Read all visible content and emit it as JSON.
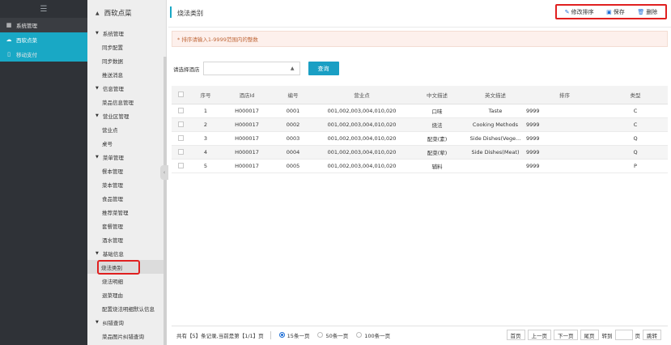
{
  "leftbar": {
    "items": [
      {
        "label": "系统管理",
        "icon": "grid-icon"
      },
      {
        "label": "西软点菜",
        "icon": "cloud-icon"
      },
      {
        "label": "移动支付",
        "icon": "phone-icon"
      }
    ]
  },
  "submenu": {
    "header": "西软点菜",
    "groups": [
      {
        "label": "系统管理",
        "items": [
          "同步配置",
          "同步数据",
          "推送消息"
        ]
      },
      {
        "label": "信息管理",
        "items": [
          "菜品信息管理"
        ]
      },
      {
        "label": "营业区管理",
        "items": [
          "营业点",
          "桌号"
        ]
      },
      {
        "label": "菜单管理",
        "items": [
          "餐本管理",
          "菜本管理",
          "食品管理",
          "推荐菜管理",
          "套餐管理",
          "酒水管理"
        ]
      },
      {
        "label": "基础信息",
        "items": [
          "烧法类别",
          "烧法明细",
          "退菜理由",
          "配置烧法明细默认信息"
        ]
      },
      {
        "label": "纠错查询",
        "items": [
          "菜品图片纠错查询"
        ]
      }
    ]
  },
  "page": {
    "title": "烧法类别",
    "actions": {
      "edit_sort": "修改排序",
      "save": "保存",
      "delete": "删除"
    },
    "notice": "* 排序请输入1-9999范围内的整数",
    "filter": {
      "label": "请选择酒店",
      "value": "",
      "query_button": "查询"
    }
  },
  "table": {
    "columns": [
      "",
      "序号",
      "酒店Id",
      "编号",
      "营业点",
      "中文描述",
      "英文描述",
      "排序",
      "类型"
    ],
    "rows": [
      [
        "1",
        "H000017",
        "0001",
        "001,002,003,004,010,020",
        "口味",
        "Taste",
        "9999",
        "C"
      ],
      [
        "2",
        "H000017",
        "0002",
        "001,002,003,004,010,020",
        "烧法",
        "Cooking Methods",
        "9999",
        "C"
      ],
      [
        "3",
        "H000017",
        "0003",
        "001,002,003,004,010,020",
        "配菜(素)",
        "Side Dishes(Vege...",
        "9999",
        "Q"
      ],
      [
        "4",
        "H000017",
        "0004",
        "001,002,003,004,010,020",
        "配菜(荤)",
        "Side Dishes(Meat)",
        "9999",
        "Q"
      ],
      [
        "5",
        "H000017",
        "0005",
        "001,002,003,004,010,020",
        "辅料",
        "",
        "9999",
        "P"
      ]
    ]
  },
  "pager": {
    "summary": "共有【5】条记录,当前是第【1/1】页",
    "size_options": [
      "15条一页",
      "50条一页",
      "100条一页"
    ],
    "selected_size": "15条一页",
    "first": "首页",
    "prev": "上一页",
    "next": "下一页",
    "last": "尾页",
    "goto_label": "转到",
    "page_unit": "页",
    "jump": "跳转"
  },
  "colors": {
    "accent": "#19a8c5",
    "highlight_border": "#e02020",
    "sidebar_bg": "#2f3237"
  }
}
